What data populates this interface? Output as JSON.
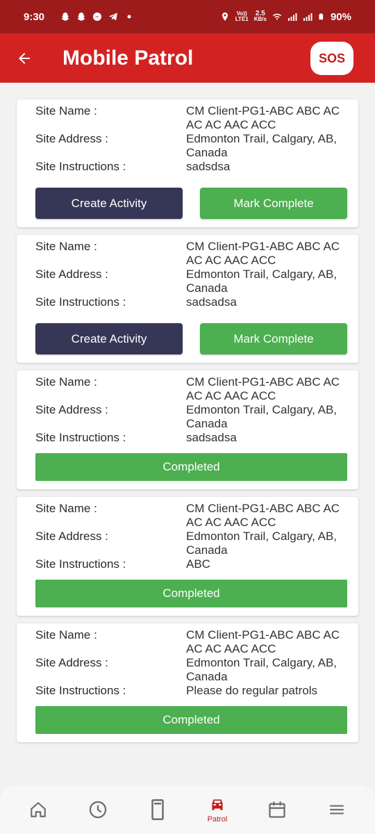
{
  "status_bar": {
    "time": "9:30",
    "battery": "90%",
    "net_speed_top": "2.5",
    "net_speed_bottom": "KB/s",
    "volte_top": "Vo))",
    "volte_bottom": "LTE1"
  },
  "app_bar": {
    "title": "Mobile Patrol",
    "sos_label": "SOS"
  },
  "labels": {
    "site_name": "Site Name :",
    "site_address": "Site Address :",
    "site_instructions": "Site Instructions :",
    "create_activity": "Create Activity",
    "mark_complete": "Mark Complete",
    "completed": "Completed"
  },
  "sites": [
    {
      "name_line1": "CM Client-PG1-ABC ABC AC",
      "name_line2": "AC AC AAC ACC",
      "address_line1": "Edmonton Trail, Calgary, AB,",
      "address_line2": "Canada",
      "instructions": "sadsdsa",
      "status": "pending"
    },
    {
      "name_line1": "CM Client-PG1-ABC ABC AC",
      "name_line2": "AC AC AAC ACC",
      "address_line1": "Edmonton Trail, Calgary, AB,",
      "address_line2": "Canada",
      "instructions": "sadsadsa",
      "status": "pending"
    },
    {
      "name_line1": "CM Client-PG1-ABC ABC AC",
      "name_line2": "AC AC AAC ACC",
      "address_line1": "Edmonton Trail, Calgary, AB,",
      "address_line2": "Canada",
      "instructions": "sadsadsa",
      "status": "completed"
    },
    {
      "name_line1": "CM Client-PG1-ABC ABC AC",
      "name_line2": "AC AC AAC ACC",
      "address_line1": "Edmonton Trail, Calgary, AB,",
      "address_line2": "Canada",
      "instructions": "ABC",
      "status": "completed"
    },
    {
      "name_line1": "CM Client-PG1-ABC ABC AC",
      "name_line2": "AC AC AAC ACC",
      "address_line1": "Edmonton Trail, Calgary, AB,",
      "address_line2": "Canada",
      "instructions": "Please do regular patrols",
      "status": "completed"
    }
  ],
  "bottom_nav": {
    "items": [
      {
        "icon": "home-icon",
        "label": ""
      },
      {
        "icon": "clock-icon",
        "label": ""
      },
      {
        "icon": "device-icon",
        "label": ""
      },
      {
        "icon": "car-icon",
        "label": "Patrol"
      },
      {
        "icon": "calendar-icon",
        "label": ""
      },
      {
        "icon": "menu-icon",
        "label": ""
      }
    ]
  },
  "colors": {
    "status_bar": "#9e1b1b",
    "app_bar": "#d32222",
    "button_dark": "#363656",
    "button_green": "#4caf50",
    "accent": "#c21d1d"
  }
}
